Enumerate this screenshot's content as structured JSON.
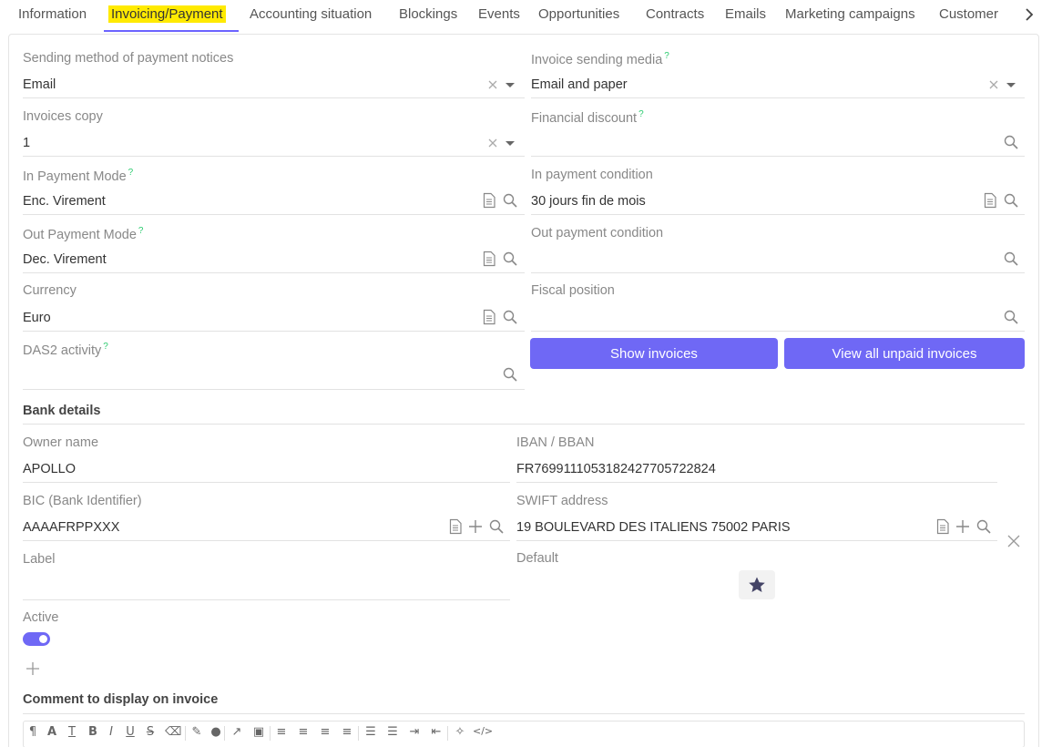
{
  "tabs": [
    {
      "label": "Information"
    },
    {
      "label": "Invoicing/Payment"
    },
    {
      "label": "Accounting situation"
    },
    {
      "label": "Blockings"
    },
    {
      "label": "Events"
    },
    {
      "label": "Opportunities"
    },
    {
      "label": "Contracts"
    },
    {
      "label": "Emails"
    },
    {
      "label": "Marketing campaigns"
    },
    {
      "label": "Customer"
    }
  ],
  "active_tab": "Invoicing/Payment",
  "form": {
    "sending_method": {
      "label": "Sending method of payment notices",
      "value": "Email"
    },
    "invoice_media": {
      "label": "Invoice sending media",
      "help": "?",
      "value": "Email and paper"
    },
    "invoices_copy": {
      "label": "Invoices copy",
      "value": "1"
    },
    "financial_discount": {
      "label": "Financial discount",
      "help": "?",
      "value": ""
    },
    "in_payment_mode": {
      "label": "In Payment Mode",
      "help": "?",
      "value": "Enc. Virement"
    },
    "in_payment_condition": {
      "label": "In payment condition",
      "value": "30 jours fin de mois"
    },
    "out_payment_mode": {
      "label": "Out Payment Mode",
      "help": "?",
      "value": "Dec. Virement"
    },
    "out_payment_condition": {
      "label": "Out payment condition",
      "value": ""
    },
    "currency": {
      "label": "Currency",
      "value": "Euro"
    },
    "fiscal_position": {
      "label": "Fiscal position",
      "value": ""
    },
    "das2_activity": {
      "label": "DAS2 activity",
      "help": "?",
      "value": ""
    },
    "show_invoices": "Show invoices",
    "view_unpaid": "View all unpaid invoices"
  },
  "bank": {
    "title": "Bank details",
    "owner_name": {
      "label": "Owner name",
      "value": "APOLLO"
    },
    "iban": {
      "label": "IBAN / BBAN",
      "value": "FR7699111053182427705722824"
    },
    "bic": {
      "label": "BIC (Bank Identifier)",
      "value": "AAAAFRPPXXX"
    },
    "swift": {
      "label": "SWIFT address",
      "value": "19 BOULEVARD DES ITALIENS 75002 PARIS"
    },
    "label": {
      "label": "Label",
      "value": ""
    },
    "default": {
      "label": "Default"
    },
    "active": {
      "label": "Active",
      "on": true
    }
  },
  "comment": {
    "title": "Comment to display on invoice"
  },
  "colors": {
    "accent": "#6f68f5",
    "highlight": "#ffea00",
    "help": "#2ecc71"
  }
}
